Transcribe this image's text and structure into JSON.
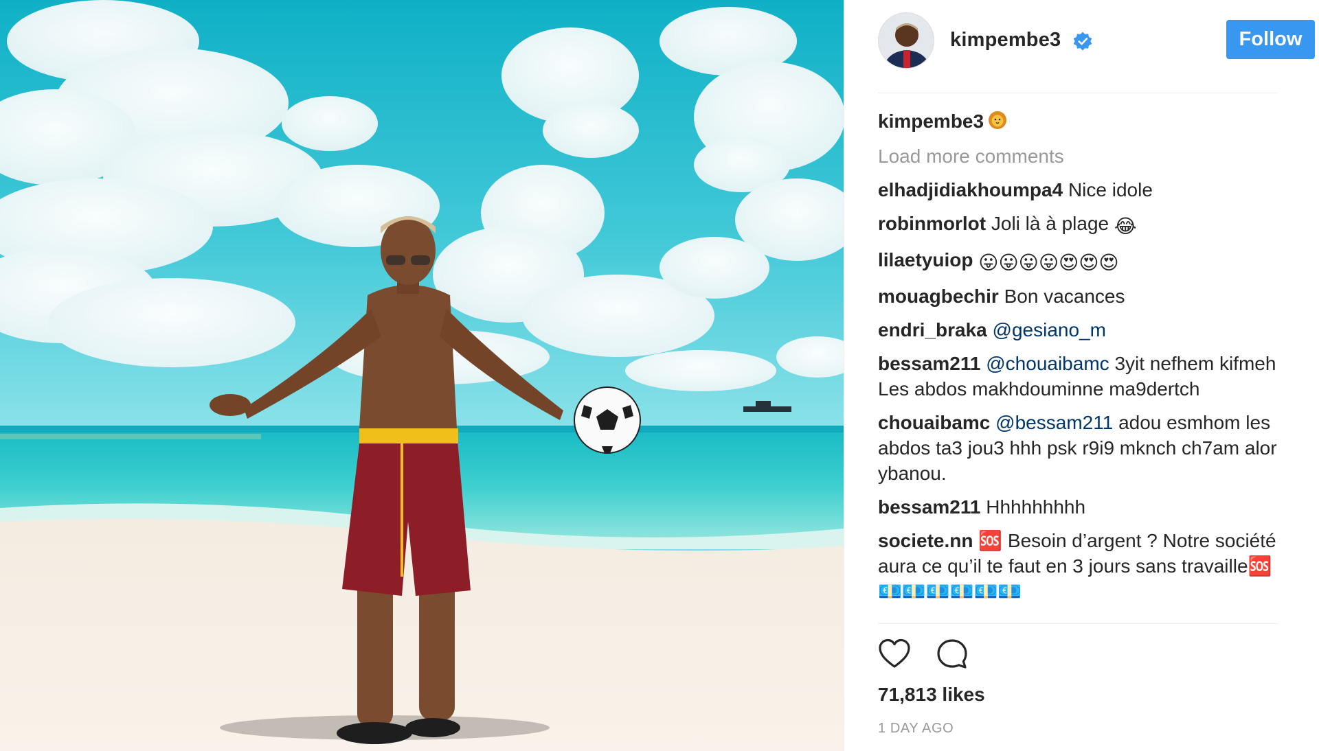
{
  "post": {
    "image_alt": "Man holding a football on a tropical beach",
    "author": {
      "username": "kimpembe3",
      "verified": true
    },
    "follow_label": "Follow",
    "caption": {
      "username": "kimpembe3",
      "emoji": "lion"
    },
    "load_more_label": "Load more comments",
    "comments": [
      {
        "user": "elhadjidiakhoumpa4",
        "text": "Nice idole"
      },
      {
        "user": "robinmorlot",
        "text": "Joli là à plage",
        "emoji": "😂"
      },
      {
        "user": "lilaetyuiop",
        "emoji_row": "😛😛😛😛😍😍😍"
      },
      {
        "user": "mouagbechir",
        "text": "Bon vacances"
      },
      {
        "user": "endri_braka",
        "mention": "@gesiano_m"
      },
      {
        "user": "bessam211",
        "mention": "@chouaibamc",
        "text": "3yit nefhem kifmeh Les abdos makhdouminne ma9dertch"
      },
      {
        "user": "chouaibamc",
        "mention": "@bessam211",
        "text": "adou esmhom les abdos ta3 jou3 hhh psk r9i9 mknch ch7am alor ybanou."
      },
      {
        "user": "bessam211",
        "text": "Hhhhhhhhh"
      },
      {
        "user": "societe.nn",
        "text": "🆘 Besoin d’argent ? Notre société aura ce qu’il te faut en 3 jours sans travaille🆘 💶💶💶💶💶💶"
      }
    ],
    "likes": "71,813 likes",
    "timestamp": "1 DAY AGO",
    "icons": {
      "like": "heart-icon",
      "comment": "comment-icon",
      "verified": "verified-badge-icon"
    },
    "colors": {
      "follow": "#3897f0",
      "mention": "#003569",
      "muted": "#999999",
      "verified": "#3897f0"
    }
  }
}
